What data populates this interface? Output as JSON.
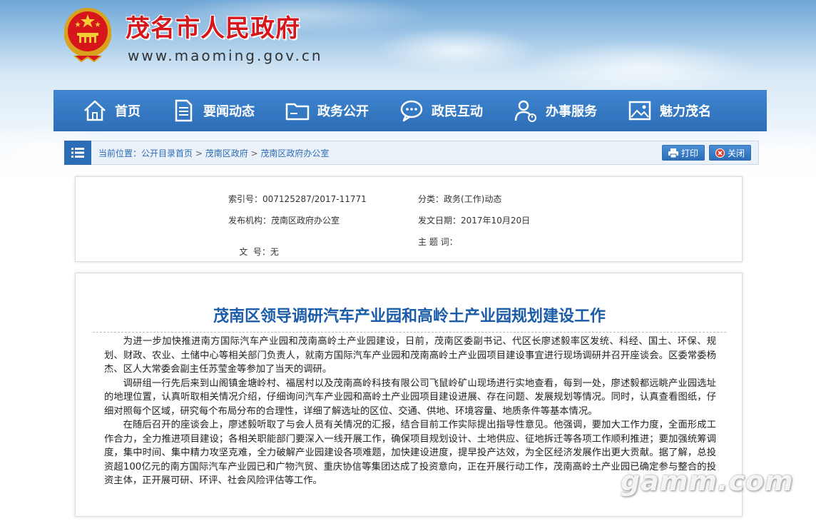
{
  "site": {
    "title": "茂名市人民政府",
    "url": "www.maoming.gov.cn"
  },
  "nav": [
    {
      "label": "首页",
      "icon": "home-icon"
    },
    {
      "label": "要闻动态",
      "icon": "document-icon"
    },
    {
      "label": "政务公开",
      "icon": "folder-icon"
    },
    {
      "label": "政民互动",
      "icon": "chat-icon"
    },
    {
      "label": "办事服务",
      "icon": "user-service-icon"
    },
    {
      "label": "魅力茂名",
      "icon": "picture-icon"
    }
  ],
  "breadcrumb": {
    "prefix": "当前位置：",
    "items": [
      "公开目录首页",
      "茂南区政府",
      "茂南区政府办公室"
    ],
    "separator": " > "
  },
  "actions": {
    "print": "打印",
    "close": "关闭"
  },
  "meta": {
    "index_label": "索引号：",
    "index_value": "007125287/2017-11771",
    "category_label": "分类：",
    "category_value": "政务(工作)动态",
    "publisher_label": "发布机构：",
    "publisher_value": "茂南区政府办公室",
    "date_label": "发文日期：",
    "date_value": "2017年10月20日",
    "docno_label": "文  号：",
    "docno_value": "无",
    "keywords_label": "主 题 词：",
    "keywords_value": ""
  },
  "article": {
    "title": "茂南区领导调研汽车产业园和高岭土产业园规划建设工作",
    "paragraphs": [
      "为进一步加快推进南方国际汽车产业园和茂南高岭土产业园建设，日前，茂南区委副书记、代区长廖述毅率区发统、科经、国土、环保、规划、财政、农业、土储中心等相关部门负责人，就南方国际汽车产业园和茂南高岭土产业园项目建设事宜进行现场调研并召开座谈会。区委常委杨杰、区人大常委会副主任苏莹金等参加了当天的调研。",
      "调研组一行先后来到山阁镇金塘岭村、福居村以及茂南高岭科技有限公司飞鼠岭矿山现场进行实地查看，每到一处，廖述毅都远眺产业园选址的地理位置，认真听取相关情况介绍，仔细询问汽车产业园和高岭土产业园项目建设进展、存在问题、发展规划等情况。同时，认真查看图纸，仔细对照每个区域，研究每个布局分布的合理性，详细了解选址的区位、交通、供地、环境容量、地质条件等基本情况。",
      "在随后召开的座谈会上，廖述毅听取了与会人员有关情况的汇报，结合目前工作实际提出指导性意见。他强调，要加大工作力度，全面形成工作合力，全力推进项目建设；各相关职能部门要深入一线开展工作，确保项目规划设计、土地供应、征地拆迁等各项工作顺利推进；要加强统筹调度，集中时间、集中精力攻坚克难，全力破解产业园建设各项难题，加快建设进度，提早投产达效，为全区经济发展作出更大贡献。据了解，总投资超100亿元的南方国际汽车产业园已和广物汽贸、重庆协信等集团达成了投资意向，正在开展行动工作，茂南高岭土产业园已确定参与整合的投资主体，正开展可研、环评、社会风险评估等工作。"
    ]
  },
  "watermark": "gamm.com"
}
